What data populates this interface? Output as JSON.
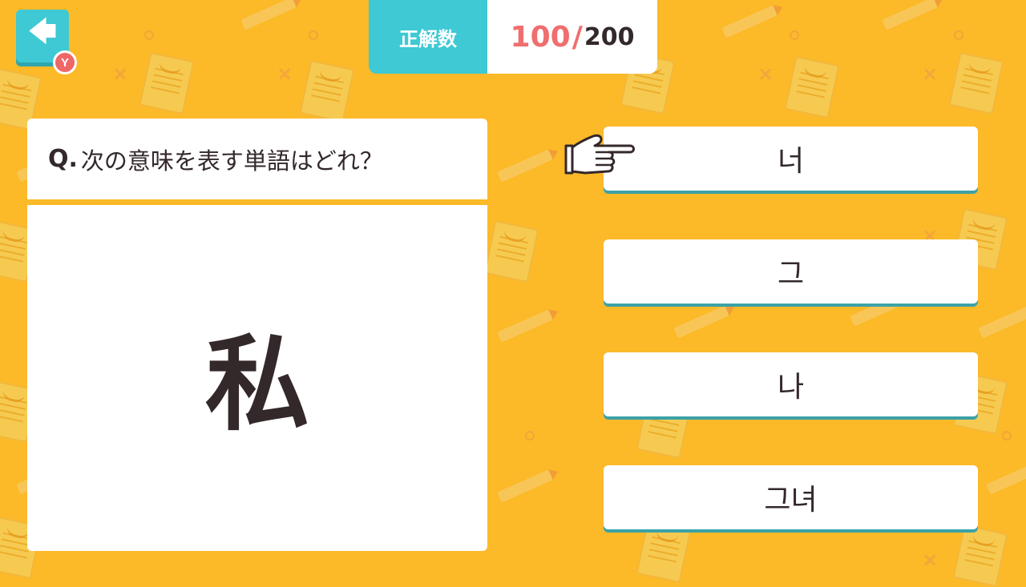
{
  "header": {
    "back_icon": "arrow-left-icon",
    "back_badge": "Y",
    "score_label": "正解数",
    "score_current": "100",
    "score_slash": "/",
    "score_total": "200"
  },
  "question": {
    "prefix": "Q.",
    "prompt": "次の意味を表す単語はどれ？",
    "word": "私"
  },
  "answers": [
    {
      "label": "너"
    },
    {
      "label": "그"
    },
    {
      "label": "나"
    },
    {
      "label": "그녀"
    }
  ],
  "cursor": {
    "icon": "pointing-hand-icon",
    "target_answer": 1
  },
  "colors": {
    "background": "#fcb928",
    "accent": "#3ec9d4",
    "score_highlight": "#f06e6e",
    "text": "#33282a"
  }
}
